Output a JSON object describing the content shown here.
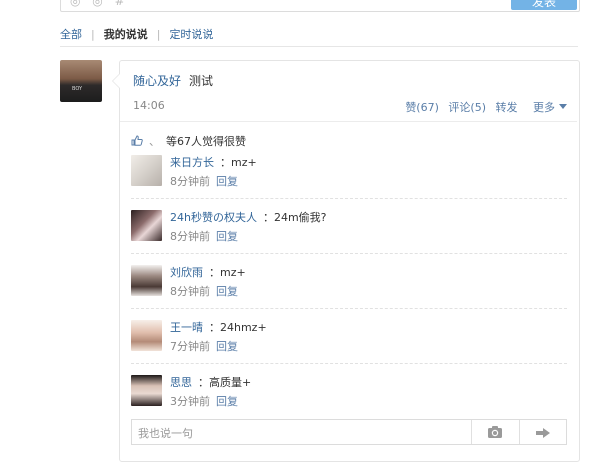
{
  "composer": {
    "publish_label": "发表"
  },
  "tabs": {
    "all": "全部",
    "mine": "我的说说",
    "scheduled": "定时说说",
    "separator": "|"
  },
  "post": {
    "author": "随心及好",
    "text": "测试",
    "time": "14:06",
    "like_action": "赞(67)",
    "comment_action": "评论(5)",
    "forward_action": "转发",
    "more_action": "更多"
  },
  "likes": {
    "separator": "、",
    "summary": "等67人觉得很赞"
  },
  "comments": [
    {
      "name": "来日方长",
      "text": "：mz+",
      "time": "8分钟前",
      "reply": "回复"
    },
    {
      "name": "24h秒赞の权夫人",
      "text": "：24m偷我?",
      "time": "8分钟前",
      "reply": "回复"
    },
    {
      "name": "刘欣雨",
      "text": "：mz+",
      "time": "8分钟前",
      "reply": "回复"
    },
    {
      "name": "王一晴",
      "text": "：24hmz+",
      "time": "7分钟前",
      "reply": "回复"
    },
    {
      "name": "思思",
      "text": "：高质量+",
      "time": "3分钟前",
      "reply": "回复"
    }
  ],
  "reply_box": {
    "placeholder": "我也说一句"
  },
  "icons": {
    "like": "thumbs-up-icon",
    "camera": "camera-icon",
    "send": "send-icon",
    "more": "chevron-down-icon"
  },
  "colors": {
    "link": "#336699",
    "publish_button": "#73b3e6",
    "muted": "#888888"
  }
}
